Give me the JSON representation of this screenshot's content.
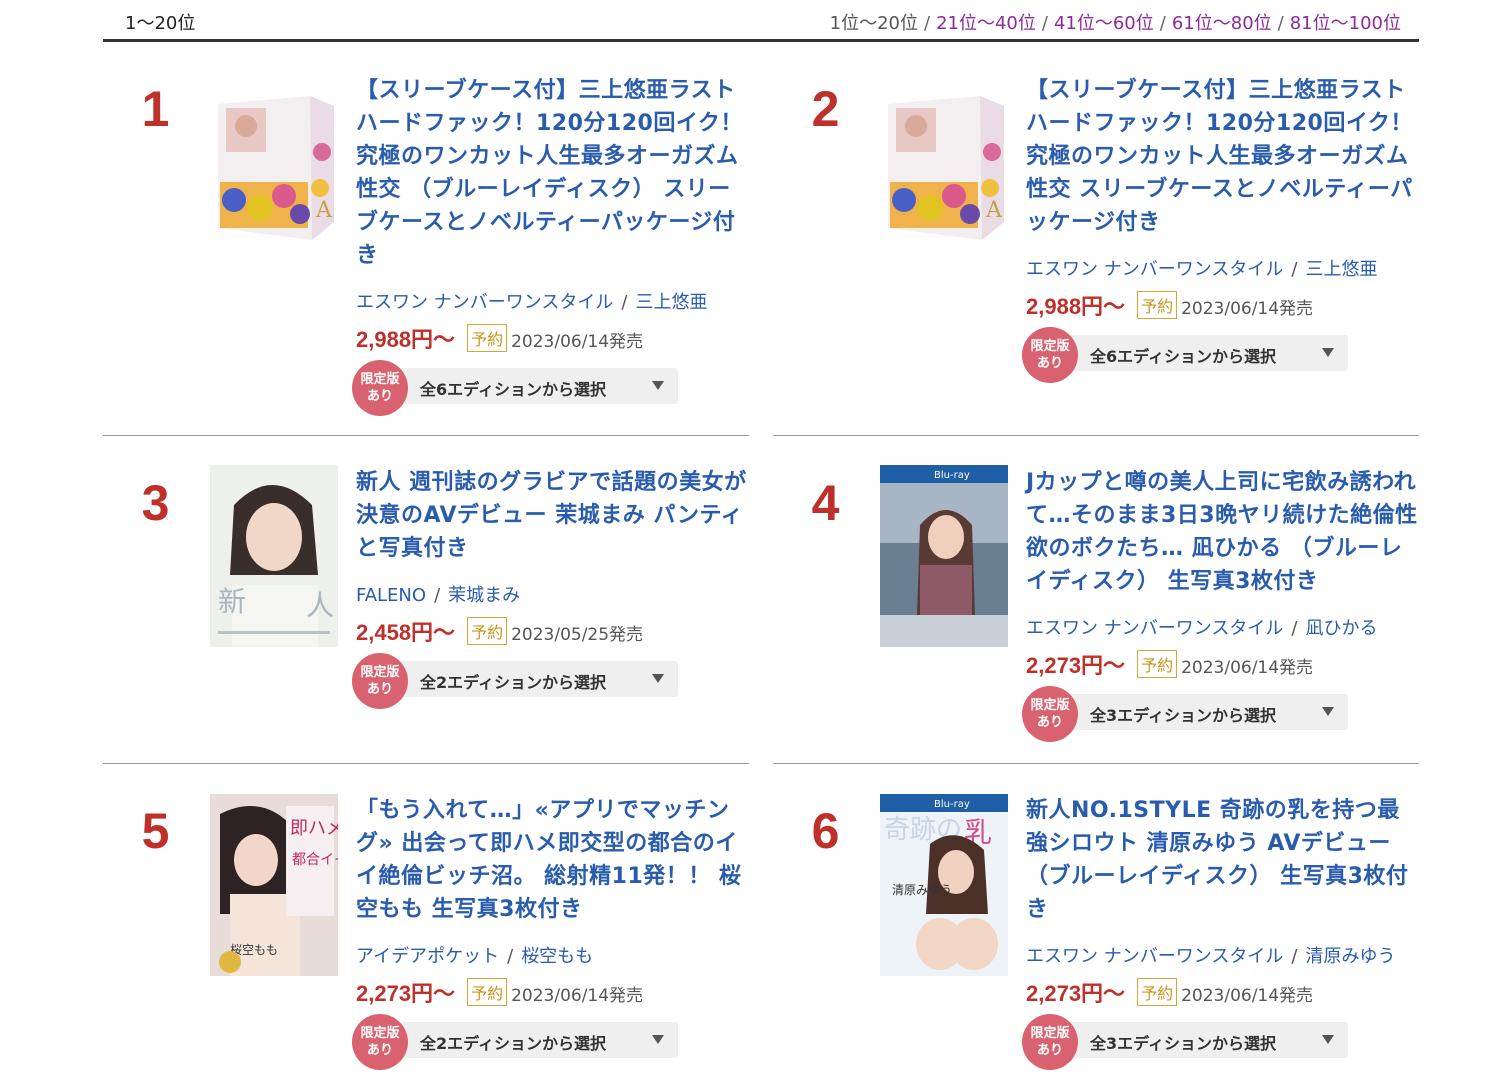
{
  "header": {
    "range_label": "1〜20位",
    "pages": [
      {
        "label": "1位〜20位",
        "current": true
      },
      {
        "label": "21位〜40位",
        "current": false
      },
      {
        "label": "41位〜60位",
        "current": false
      },
      {
        "label": "61位〜80位",
        "current": false
      },
      {
        "label": "81位〜100位",
        "current": false
      }
    ]
  },
  "items": [
    {
      "rank": "1",
      "title": "【スリーブケース付】三上悠亜ラストハードファック！120分120回イク！究極のワンカット人生最多オーガズム性交 （ブルーレイディスク） スリーブケースとノベルティーパッケージ付き",
      "maker": "エスワン ナンバーワンスタイル",
      "actress": "三上悠亜",
      "price": "2,988円〜",
      "badge": "予約",
      "date": "2023/06/14発売",
      "limited_label": "限定版あり",
      "edition_label": "全6エディションから選択"
    },
    {
      "rank": "2",
      "title": "【スリーブケース付】三上悠亜ラストハードファック！120分120回イク！究極のワンカット人生最多オーガズム性交 スリーブケースとノベルティーパッケージ付き",
      "maker": "エスワン ナンバーワンスタイル",
      "actress": "三上悠亜",
      "price": "2,988円〜",
      "badge": "予約",
      "date": "2023/06/14発売",
      "limited_label": "限定版あり",
      "edition_label": "全6エディションから選択"
    },
    {
      "rank": "3",
      "title": "新人 週刊誌のグラビアで話題の美女が決意のAVデビュー 茉城まみ パンティと写真付き",
      "maker": "FALENO",
      "actress": "茉城まみ",
      "price": "2,458円〜",
      "badge": "予約",
      "date": "2023/05/25発売",
      "limited_label": "限定版あり",
      "edition_label": "全2エディションから選択"
    },
    {
      "rank": "4",
      "title": "Jカップと噂の美人上司に宅飲み誘われて…そのまま3日3晩ヤリ続けた絶倫性欲のボクたち… 凪ひかる （ブルーレイディスク） 生写真3枚付き",
      "maker": "エスワン ナンバーワンスタイル",
      "actress": "凪ひかる",
      "price": "2,273円〜",
      "badge": "予約",
      "date": "2023/06/14発売",
      "limited_label": "限定版あり",
      "edition_label": "全3エディションから選択"
    },
    {
      "rank": "5",
      "title": "「もう入れて…」«アプリでマッチング» 出会って即ハメ即交型の都合のイイ絶倫ビッチ沼。 総射精11発！！ 桜空もも 生写真3枚付き",
      "maker": "アイデアポケット",
      "actress": "桜空もも",
      "price": "2,273円〜",
      "badge": "予約",
      "date": "2023/06/14発売",
      "limited_label": "限定版あり",
      "edition_label": "全2エディションから選択"
    },
    {
      "rank": "6",
      "title": "新人NO.1STYLE 奇跡の乳を持つ最強シロウト 清原みゆう AVデビュー （ブルーレイディスク） 生写真3枚付き",
      "maker": "エスワン ナンバーワンスタイル",
      "actress": "清原みゆう",
      "price": "2,273円〜",
      "badge": "予約",
      "date": "2023/06/14発売",
      "limited_label": "限定版あり",
      "edition_label": "全3エディションから選択"
    }
  ]
}
